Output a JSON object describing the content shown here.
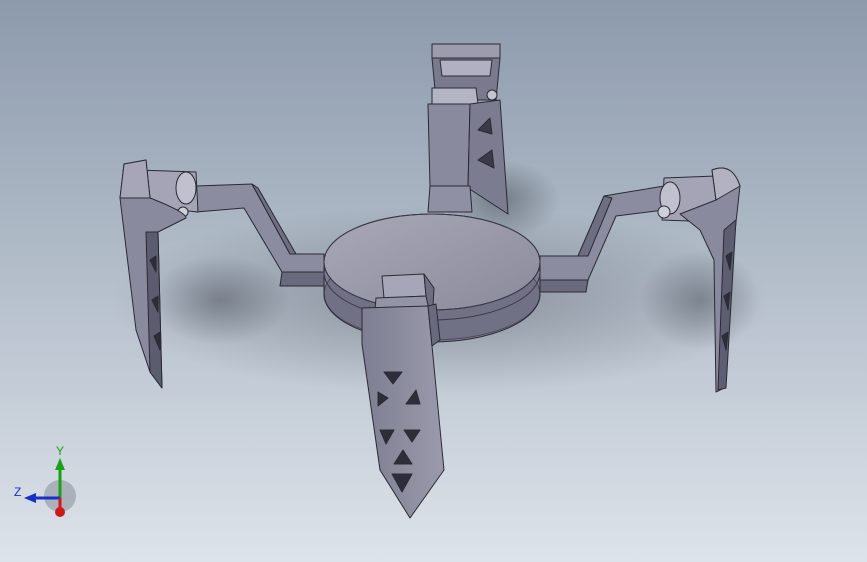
{
  "viewport": {
    "background_top": "#8c9aac",
    "background_bottom": "#dde3ea"
  },
  "model": {
    "body_color": "#8e8ea0",
    "dark_color": "#5a5a6c",
    "light_color": "#b6b6c6",
    "edge_color": "#2a2a34"
  },
  "triad": {
    "x_label": "",
    "y_label": "Y",
    "z_label": "Z",
    "x_color": "#d01818",
    "y_color": "#18a018",
    "z_color": "#1830c8"
  }
}
